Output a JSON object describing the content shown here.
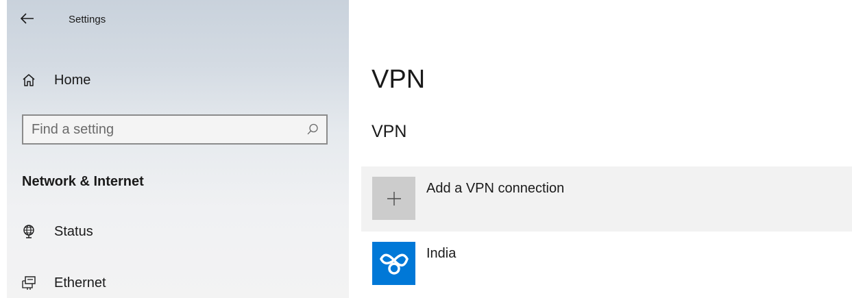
{
  "window": {
    "title": "Settings"
  },
  "sidebar": {
    "home_label": "Home",
    "search": {
      "placeholder": "Find a setting",
      "value": ""
    },
    "section_heading": "Network & Internet",
    "items": [
      {
        "label": "Status",
        "icon": "globe-icon"
      },
      {
        "label": "Ethernet",
        "icon": "ethernet-icon"
      }
    ]
  },
  "main": {
    "page_title": "VPN",
    "group_title": "VPN",
    "add_connection_label": "Add a VPN connection",
    "connections": [
      {
        "name": "India",
        "icon": "vpn-app-icon",
        "icon_color": "#0078d7"
      }
    ]
  },
  "colors": {
    "accent": "#0078d7",
    "row_hover": "#f2f2f2",
    "add_tile": "#cccccc"
  }
}
